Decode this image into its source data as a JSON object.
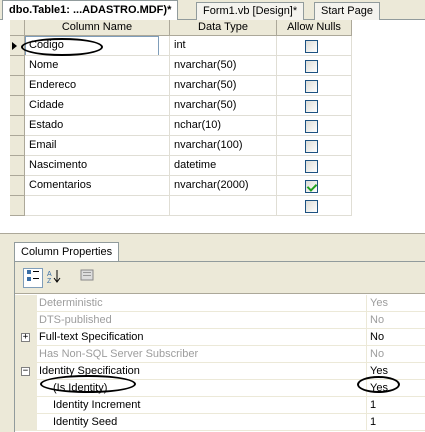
{
  "tabs": [
    {
      "label": "dbo.Table1: ...ADASTRO.MDF)*",
      "active": true
    },
    {
      "label": "Form1.vb [Design]*",
      "active": false
    },
    {
      "label": "Start Page",
      "active": false
    }
  ],
  "grid": {
    "headers": [
      "Column Name",
      "Data Type",
      "Allow Nulls"
    ],
    "rows": [
      {
        "name": "Codigo",
        "type": "int",
        "allow_nulls": false
      },
      {
        "name": "Nome",
        "type": "nvarchar(50)",
        "allow_nulls": false
      },
      {
        "name": "Endereco",
        "type": "nvarchar(50)",
        "allow_nulls": false
      },
      {
        "name": "Cidade",
        "type": "nvarchar(50)",
        "allow_nulls": false
      },
      {
        "name": "Estado",
        "type": "nchar(10)",
        "allow_nulls": false
      },
      {
        "name": "Email",
        "type": "nvarchar(100)",
        "allow_nulls": false
      },
      {
        "name": "Nascimento",
        "type": "datetime",
        "allow_nulls": false
      },
      {
        "name": "Comentarios",
        "type": "nvarchar(2000)",
        "allow_nulls": true
      },
      {
        "name": "",
        "type": "",
        "allow_nulls": false
      }
    ]
  },
  "column_properties": {
    "tab_label": "Column Properties",
    "toolbar": [
      "categorized-icon",
      "alphabetical-icon",
      "property-pages-icon"
    ],
    "properties": [
      {
        "name": "Deterministic",
        "value": "Yes",
        "disabled": true,
        "expander": ""
      },
      {
        "name": "DTS-published",
        "value": "No",
        "disabled": true,
        "expander": ""
      },
      {
        "name": "Full-text Specification",
        "value": "No",
        "disabled": false,
        "expander": "+"
      },
      {
        "name": "Has Non-SQL Server Subscriber",
        "value": "No",
        "disabled": true,
        "expander": ""
      },
      {
        "name": "Identity Specification",
        "value": "Yes",
        "disabled": false,
        "expander": "−"
      },
      {
        "name": "(Is Identity)",
        "value": "Yes",
        "disabled": false,
        "expander": "",
        "indent": true
      },
      {
        "name": "Identity Increment",
        "value": "1",
        "disabled": false,
        "expander": "",
        "indent": true
      },
      {
        "name": "Identity Seed",
        "value": "1",
        "disabled": false,
        "expander": "",
        "indent": true
      }
    ]
  }
}
